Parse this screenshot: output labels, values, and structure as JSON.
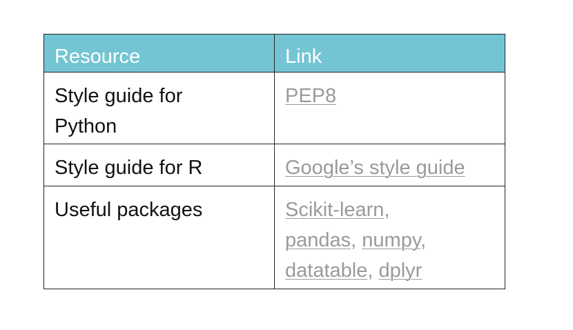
{
  "table": {
    "headers": [
      "Resource",
      "Link"
    ],
    "rows": [
      {
        "resource_line1": "Style guide for",
        "resource_line2": "Python",
        "links": [
          "PEP8"
        ]
      },
      {
        "resource": "Style guide for R",
        "links": [
          "Google’s style guide"
        ]
      },
      {
        "resource": "Useful packages",
        "links": [
          "Scikit-learn",
          "pandas",
          "numpy",
          "datatable",
          "dplyr"
        ]
      }
    ],
    "separator": ","
  },
  "colors": {
    "header_bg": "#74c5d3",
    "header_text": "#ffffff",
    "link_text": "#9a9a9a",
    "border": "#222222"
  }
}
